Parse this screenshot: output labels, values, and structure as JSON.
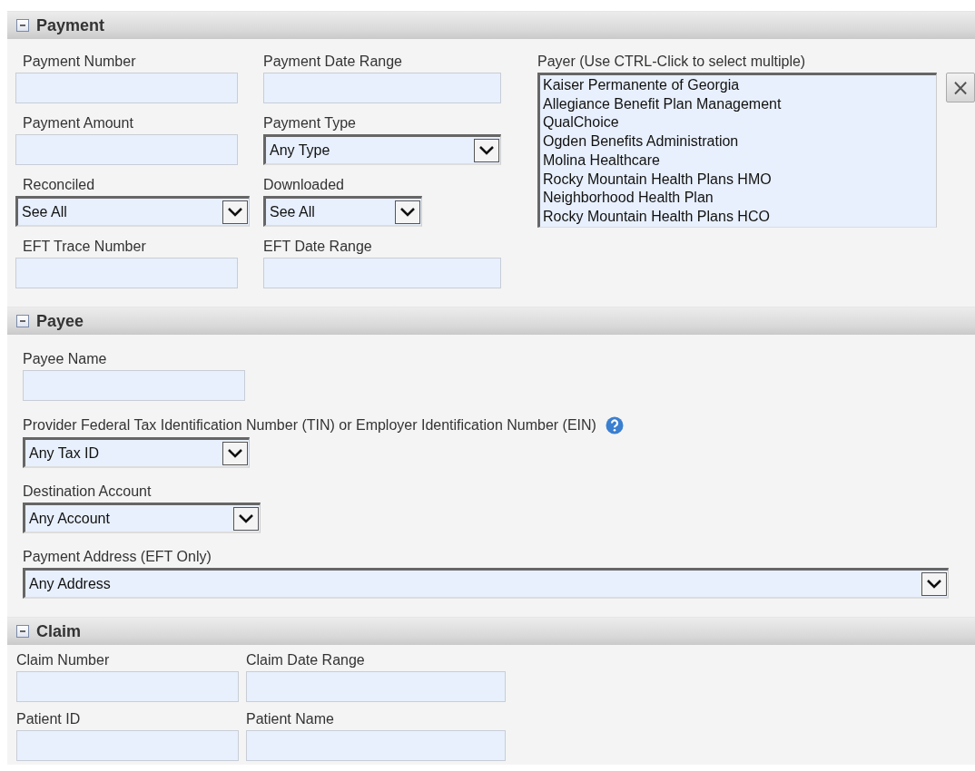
{
  "sections": [
    {
      "title": "Payment",
      "expanded": true,
      "fields": [
        {
          "label": "Payment Number",
          "kind": "text"
        },
        {
          "label": "Payment Date Range",
          "kind": "text"
        },
        {
          "label": "Payment Amount",
          "kind": "text"
        },
        {
          "label": "Payment Type",
          "kind": "select",
          "value": "Any Type"
        },
        {
          "label": "Reconciled",
          "kind": "select",
          "value": "See All"
        },
        {
          "label": "Downloaded",
          "kind": "select",
          "value": "See All"
        },
        {
          "label": "EFT Trace Number",
          "kind": "text"
        },
        {
          "label": "EFT Date Range",
          "kind": "text"
        }
      ],
      "payer": {
        "label": "Payer  (Use CTRL-Click to select multiple)",
        "options": [
          "Kaiser Permanente of Georgia",
          "Allegiance Benefit Plan Management",
          "QualChoice",
          "Ogden Benefits Administration",
          "Molina Healthcare",
          "Rocky Mountain Health Plans HMO",
          "Neighborhood Health Plan",
          "Rocky Mountain Health Plans HCO"
        ],
        "clear": "×"
      }
    },
    {
      "title": "Payee",
      "expanded": true,
      "fields": [
        {
          "label": "Payee Name",
          "kind": "text"
        },
        {
          "label": "Provider Federal Tax Identification Number (TIN) or Employer Identification Number (EIN)",
          "kind": "select",
          "value": "Any Tax ID",
          "help": true
        },
        {
          "label": "Destination Account",
          "kind": "select",
          "value": "Any Account"
        },
        {
          "label": "Payment Address (EFT Only)",
          "kind": "select",
          "value": "Any Address"
        }
      ]
    },
    {
      "title": "Claim",
      "expanded": true,
      "fields": [
        {
          "label": "Claim Number",
          "kind": "text"
        },
        {
          "label": "Claim Date Range",
          "kind": "text"
        },
        {
          "label": "Patient ID",
          "kind": "text"
        },
        {
          "label": "Patient Name",
          "kind": "text"
        }
      ]
    }
  ]
}
